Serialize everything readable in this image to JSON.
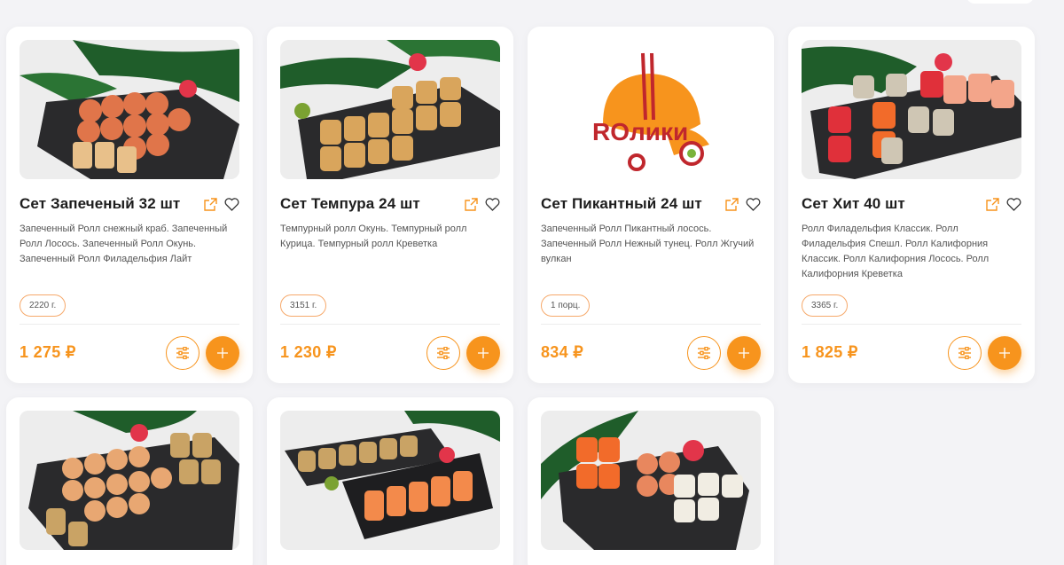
{
  "currency_symbol": "₽",
  "accent_color": "#f7941d",
  "products": [
    {
      "title": "Сет Запеченый 32 шт",
      "description": "Запеченный Ролл снежный краб. Запеченный Ролл Лосось. Запеченный Ролл Окунь. Запеченный Ролл Филадельфия Лайт",
      "weight": "2220 г.",
      "price": "1 275 ₽",
      "image": "baked-set-photo"
    },
    {
      "title": "Сет Темпура 24 шт",
      "description": "Темпурный ролл Окунь. Темпурный ролл Курица. Темпурный ролл Креветка",
      "weight": "3151 г.",
      "price": "1 230 ₽",
      "image": "tempura-set-photo"
    },
    {
      "title": "Сет Пикантный 24 шт",
      "description": "Запеченный Ролл Пикантный лосось. Запеченный Ролл Нежный тунец. Ролл Жгучий вулкан",
      "weight": "1 порц.",
      "price": "834 ₽",
      "image": "rolliki-logo",
      "logo_text": "ROлики"
    },
    {
      "title": "Сет Хит 40 шт",
      "description": "Ролл Филадельфия Классик. Ролл Филадельфия Спешл. Ролл Калифорния Классик. Ролл Калифорния Лосось. Ролл Калифорния Креветка",
      "weight": "3365 г.",
      "price": "1 825 ₽",
      "image": "hit-set-photo"
    }
  ],
  "products_row2": [
    {
      "image": "baked-mix-set-photo"
    },
    {
      "image": "two-board-set-photo"
    },
    {
      "image": "philadelphia-set-photo"
    }
  ]
}
